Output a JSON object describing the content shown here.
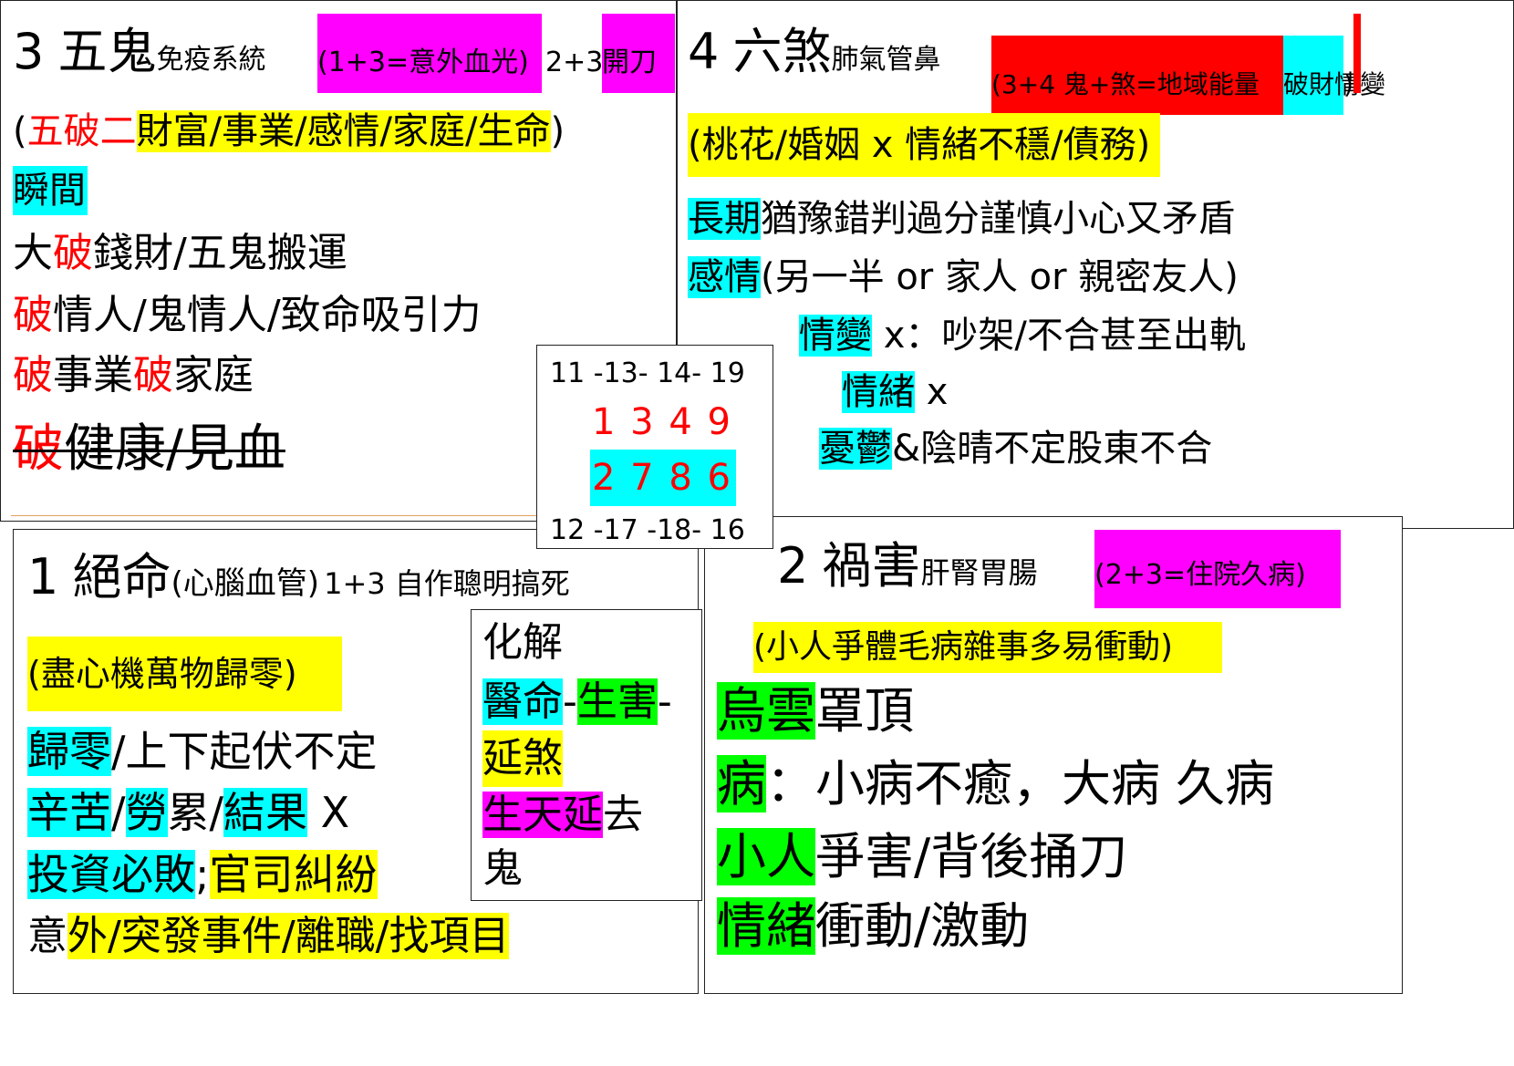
{
  "q3": {
    "number": "3",
    "title": "五鬼",
    "sub": "免疫系統",
    "combo1": "(1+3=意外血光)",
    "combo2a": "2+3",
    "combo2b": "開刀",
    "line1_paren_open": "(",
    "line1_red": "五破二",
    "line1_hl": "財富/事業/感情/家庭/生命",
    "line1_paren_close": ")",
    "line2": "瞬間",
    "line3_a": "大",
    "line3_b": "破",
    "line3_c": "錢財/五鬼搬運",
    "line4_a": "破",
    "line4_b": "情人/鬼情人/致命吸引力",
    "line5_a": "破",
    "line5_b": "事業",
    "line5_c": "破",
    "line5_d": "家庭",
    "line6_a": "破",
    "line6_b": "健康/見血"
  },
  "q4": {
    "number": "4",
    "title": "六煞",
    "sub": "肺氣管鼻",
    "combo_a": "(3+4 鬼+煞=地域能量",
    "combo_b": "破財情變",
    "combo_c": ")",
    "line1": "(桃花/婚姻 x 情緒不穩/債務)",
    "line2_hl": "長期",
    "line2_rest": "猶豫錯判過分謹慎小心又矛盾",
    "line3_hl": "感情",
    "line3_rest": "(另一半 or 家人 or 親密友人)",
    "line4_hl": "情變",
    "line4_rest": " x：吵架/不合甚至出軌",
    "line5_hl": "情緒",
    "line5_rest": " x",
    "line6_hl": "憂鬱",
    "line6_rest": "&陰晴不定股東不合"
  },
  "center": {
    "top": "11 -13- 14- 19",
    "row1": "1 3 4 9",
    "row2": "2 7 8 6",
    "bottom": "12 -17 -18- 16"
  },
  "q1": {
    "number": "1",
    "title": "絕命",
    "sub": "(心腦血管)",
    "combo": "1+3 自作聰明搞死",
    "line1": "(盡心機萬物歸零)",
    "line2_hl": "歸零",
    "line2_rest": "/上下起伏不定",
    "line3_a": "辛苦",
    "line3_b": "/",
    "line3_c": "勞",
    "line3_d": "累/",
    "line3_e": "結果",
    "line3_f": " X",
    "line4_hl": "投資必敗",
    "line4_sep": ";",
    "line4_y": "官司糾紛",
    "line5_a": "意",
    "line5_b": "外/突發事件/離職/找項目"
  },
  "remedy": {
    "title": "化解",
    "l1_a": "醫命",
    "l1_b": "-",
    "l1_c": "生害",
    "l1_d": "-",
    "l2": "延煞",
    "l3_a": "生天延",
    "l3_b": "去",
    "l4": "鬼"
  },
  "q2": {
    "number": "2",
    "title": "禍害",
    "sub": "肝腎胃腸",
    "combo": "(2+3=住院久病)",
    "line1": "(小人爭體毛病雜事多易衝動)",
    "line2_hl": "烏雲",
    "line2_rest": "罩頂",
    "line3_hl": "病",
    "line3_rest": "：小病不癒，大病  久病",
    "line4_hl": "小人",
    "line4_rest": "爭害/背後捅刀",
    "line5_hl": "情緒",
    "line5_rest": "衝動/激動"
  }
}
